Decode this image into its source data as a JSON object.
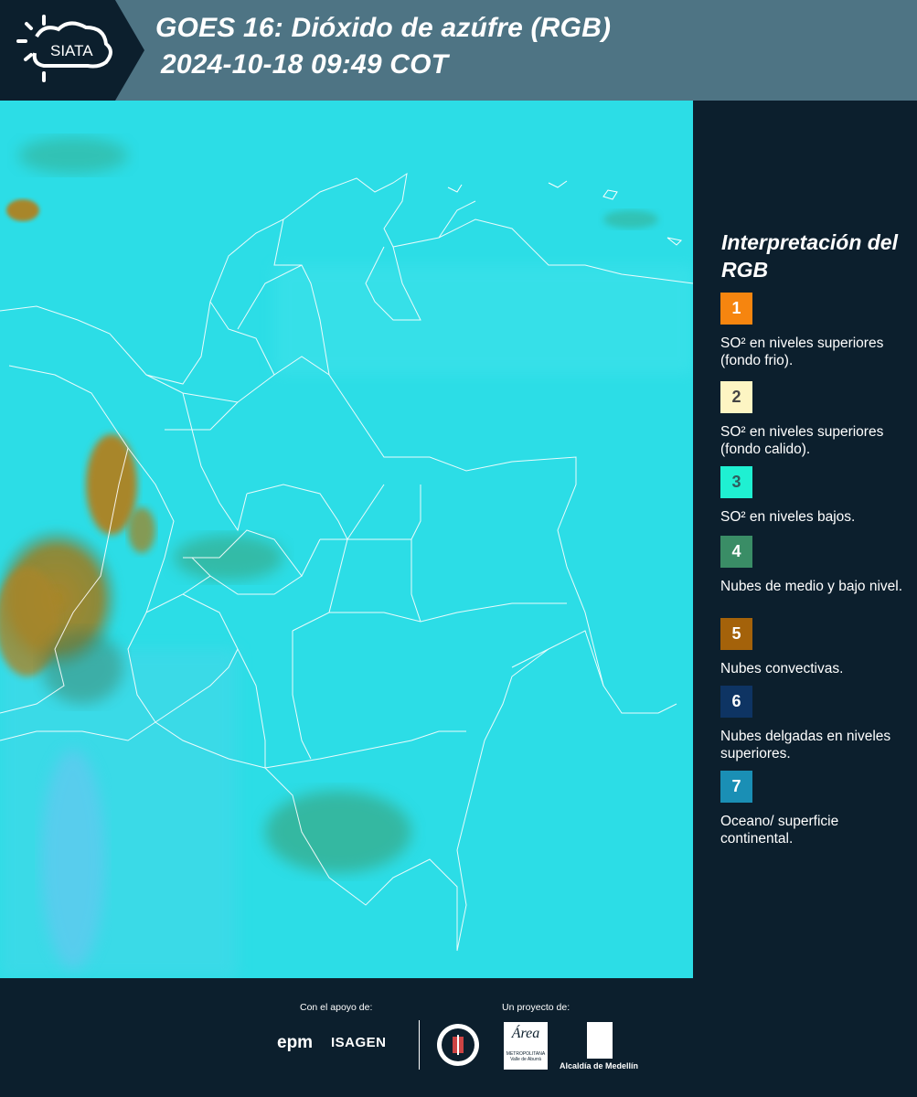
{
  "header": {
    "logo_text": "SIATA",
    "title_line1": "GOES 16: Dióxido de azúfre (RGB)",
    "title_line2": "2024-10-18 09:49 COT",
    "bg_color": "#4e7484",
    "logo_bg_color": "#0c1f2d"
  },
  "map": {
    "base_color": "#2cdde6",
    "convective_color": "#a8862a",
    "low_cloud_color": "#3a9a6a",
    "thin_cloud_color": "#5fc8f0",
    "border_color": "#ffffff"
  },
  "legend": {
    "title": "Interpretación del RGB",
    "items": [
      {
        "number": "1",
        "color": "#f6850f",
        "text_color": "#ffffff",
        "label": "SO² en niveles superiores (fondo frio)."
      },
      {
        "number": "2",
        "color": "#fdf5c3",
        "text_color": "#444444",
        "label": "SO² en niveles superiores (fondo calido)."
      },
      {
        "number": "3",
        "color": "#1ff0d2",
        "text_color": "#2f5d5d",
        "label": "SO² en niveles bajos."
      },
      {
        "number": "4",
        "color": "#3a8d66",
        "text_color": "#ffffff",
        "label": "Nubes de medio y bajo nivel."
      },
      {
        "number": "5",
        "color": "#a4620a",
        "text_color": "#ffffff",
        "label": "Nubes convectivas."
      },
      {
        "number": "6",
        "color": "#0e3463",
        "text_color": "#ffffff",
        "label": "Nubes delgadas en niveles superiores."
      },
      {
        "number": "7",
        "color": "#1a8fb5",
        "text_color": "#ffffff",
        "label": "Oceano/ superficie continental."
      }
    ]
  },
  "footer": {
    "support_label": "Con el apoyo de:",
    "project_label": "Un proyecto de:",
    "sponsors": [
      "epm",
      "ISAGEN"
    ],
    "area_logo_text": "Área",
    "area_logo_sub": "METROPOLITANA Valle de Aburrá",
    "alcaldia_label": "Alcaldía de Medellín"
  }
}
